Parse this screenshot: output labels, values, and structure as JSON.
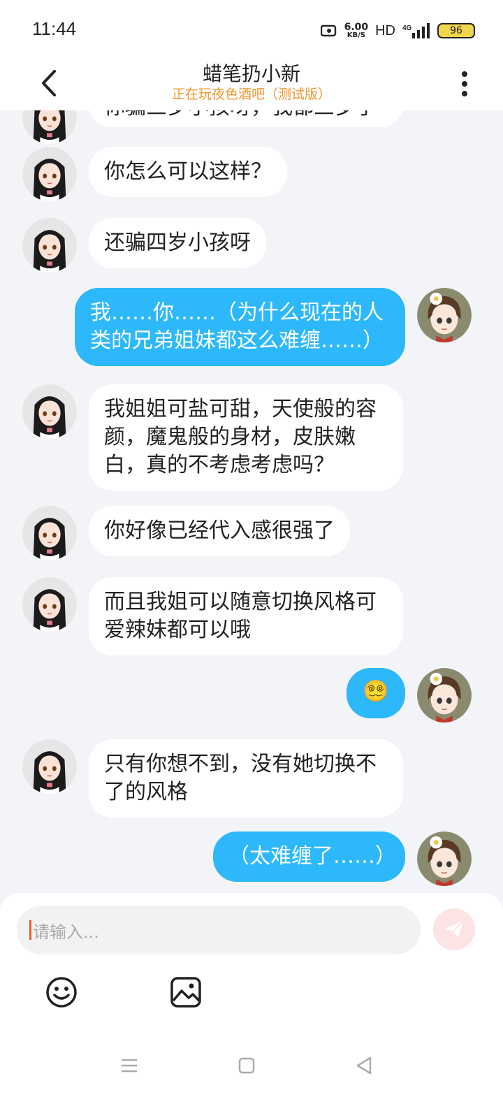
{
  "status_bar": {
    "time": "11:44",
    "net_speed_value": "6.00",
    "net_speed_unit": "KB/S",
    "hd": "HD",
    "network": "4G",
    "battery": "96"
  },
  "header": {
    "title": "蜡笔扔小新",
    "subtitle": "正在玩夜色酒吧（测试版）"
  },
  "messages": [
    {
      "from": "other",
      "text": "你骗三岁小孩呀，我都三岁了"
    },
    {
      "from": "other",
      "text": "你怎么可以这样？"
    },
    {
      "from": "other",
      "text": "还骗四岁小孩呀"
    },
    {
      "from": "me",
      "text": "我……你……（为什么现在的人类的兄弟姐妹都这么难缠……）"
    },
    {
      "from": "other",
      "text": "我姐姐可盐可甜，天使般的容颜，魔鬼般的身材，皮肤嫩白，真的不考虑考虑吗？"
    },
    {
      "from": "other",
      "text": "你好像已经代入感很强了"
    },
    {
      "from": "other",
      "text": "而且我姐可以随意切换风格可爱辣妹都可以哦"
    },
    {
      "from": "me",
      "text": "😵‍💫"
    },
    {
      "from": "other",
      "text": "只有你想不到，没有她切换不了的风格"
    },
    {
      "from": "me",
      "text": "（太难缠了……）"
    }
  ],
  "input": {
    "placeholder": "请输入..."
  },
  "colors": {
    "accent_blue": "#2cb8fb",
    "subtitle_orange": "#f0962d",
    "background": "#f2f4f7"
  },
  "icons": {
    "back": "chevron-left-icon",
    "more": "more-vertical-icon",
    "send": "send-icon",
    "emoji": "smile-icon",
    "image": "image-icon",
    "nav_menu": "menu-icon",
    "nav_home": "square-icon",
    "nav_back": "triangle-back-icon"
  }
}
